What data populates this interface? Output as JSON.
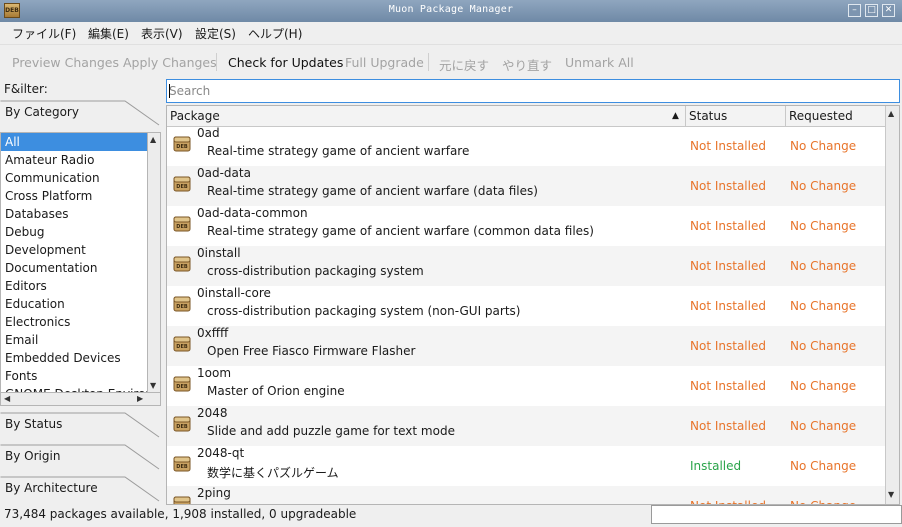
{
  "window": {
    "title": "Muon Package Manager",
    "icon_label": "DEB"
  },
  "menu": [
    "ファイル(F)",
    "編集(E)",
    "表示(V)",
    "設定(S)",
    "ヘルプ(H)"
  ],
  "toolbar": {
    "preview": "Preview Changes",
    "apply": "Apply Changes",
    "check": "Check for Updates",
    "full": "Full Upgrade",
    "undo": "元に戻す",
    "redo": "やり直す",
    "unmark": "Unmark All"
  },
  "filter": {
    "label": "F&ilter:",
    "by_category": "By Category",
    "categories": [
      "All",
      "Amateur Radio",
      "Communication",
      "Cross Platform",
      "Databases",
      "Debug",
      "Development",
      "Documentation",
      "Editors",
      "Education",
      "Electronics",
      "Email",
      "Embedded Devices",
      "Fonts",
      "GNOME Desktop Environm"
    ],
    "by_status": "By Status",
    "by_origin": "By Origin",
    "by_architecture": "By Architecture"
  },
  "search": {
    "placeholder": "Search"
  },
  "table": {
    "headers": {
      "package": "Package",
      "status": "Status",
      "requested": "Requested"
    },
    "rows": [
      {
        "name": "0ad",
        "desc": "Real-time strategy game of ancient warfare",
        "status": "Not Installed",
        "requested": "No Change"
      },
      {
        "name": "0ad-data",
        "desc": "Real-time strategy game of ancient warfare (data files)",
        "status": "Not Installed",
        "requested": "No Change"
      },
      {
        "name": "0ad-data-common",
        "desc": "Real-time strategy game of ancient warfare (common data files)",
        "status": "Not Installed",
        "requested": "No Change"
      },
      {
        "name": "0install",
        "desc": "cross-distribution packaging system",
        "status": "Not Installed",
        "requested": "No Change"
      },
      {
        "name": "0install-core",
        "desc": "cross-distribution packaging system (non-GUI parts)",
        "status": "Not Installed",
        "requested": "No Change"
      },
      {
        "name": "0xffff",
        "desc": "Open Free Fiasco Firmware Flasher",
        "status": "Not Installed",
        "requested": "No Change"
      },
      {
        "name": "1oom",
        "desc": "Master of Orion engine",
        "status": "Not Installed",
        "requested": "No Change"
      },
      {
        "name": "2048",
        "desc": "Slide and add puzzle game for text mode",
        "status": "Not Installed",
        "requested": "No Change"
      },
      {
        "name": "2048-qt",
        "desc": "数学に基くパズルゲーム",
        "status": "Installed",
        "requested": "No Change"
      },
      {
        "name": "2ping",
        "desc": "",
        "status": "Not Installed",
        "requested": "No Change"
      }
    ]
  },
  "colors": {
    "not_installed": "#e8742a",
    "installed": "#2aa44a",
    "no_change": "#e8742a",
    "selection": "#3d8ee0"
  },
  "statusbar": {
    "text": "73,484 packages available, 1,908 installed, 0 upgradeable"
  }
}
